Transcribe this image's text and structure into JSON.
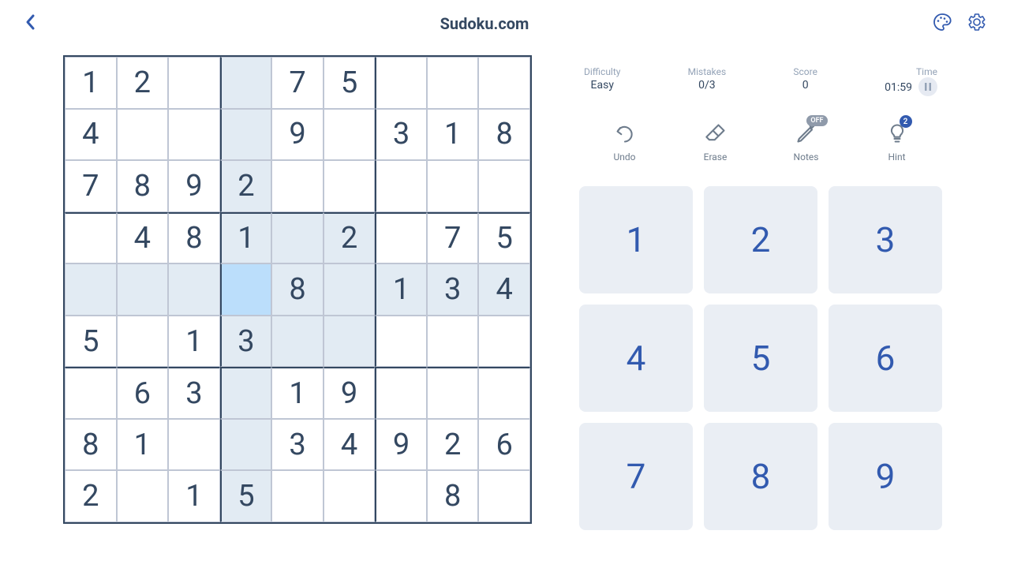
{
  "header": {
    "title": "Sudoku.com"
  },
  "stats": {
    "difficulty_label": "Difficulty",
    "difficulty_value": "Easy",
    "mistakes_label": "Mistakes",
    "mistakes_value": "0/3",
    "score_label": "Score",
    "score_value": "0",
    "time_label": "Time",
    "time_value": "01:59"
  },
  "tools": {
    "undo": "Undo",
    "erase": "Erase",
    "notes": "Notes",
    "notes_state": "OFF",
    "hint": "Hint",
    "hint_count": "2"
  },
  "numpad": [
    "1",
    "2",
    "3",
    "4",
    "5",
    "6",
    "7",
    "8",
    "9"
  ],
  "board": {
    "selected": [
      4,
      3
    ],
    "cells": [
      [
        "1",
        "2",
        "",
        "",
        "7",
        "5",
        "",
        "",
        ""
      ],
      [
        "4",
        "",
        "",
        "",
        "9",
        "",
        "3",
        "1",
        "8"
      ],
      [
        "7",
        "8",
        "9",
        "2",
        "",
        "",
        "",
        "",
        ""
      ],
      [
        "",
        "4",
        "8",
        "1",
        "",
        "2",
        "",
        "7",
        "5"
      ],
      [
        "",
        "",
        "",
        "",
        "8",
        "",
        "1",
        "3",
        "4"
      ],
      [
        "5",
        "",
        "1",
        "3",
        "",
        "",
        "",
        "",
        ""
      ],
      [
        "",
        "6",
        "3",
        "",
        "1",
        "9",
        "",
        "",
        ""
      ],
      [
        "8",
        "1",
        "",
        "",
        "3",
        "4",
        "9",
        "2",
        "6"
      ],
      [
        "2",
        "",
        "1",
        "5",
        "",
        "",
        "",
        "8",
        ""
      ]
    ]
  }
}
